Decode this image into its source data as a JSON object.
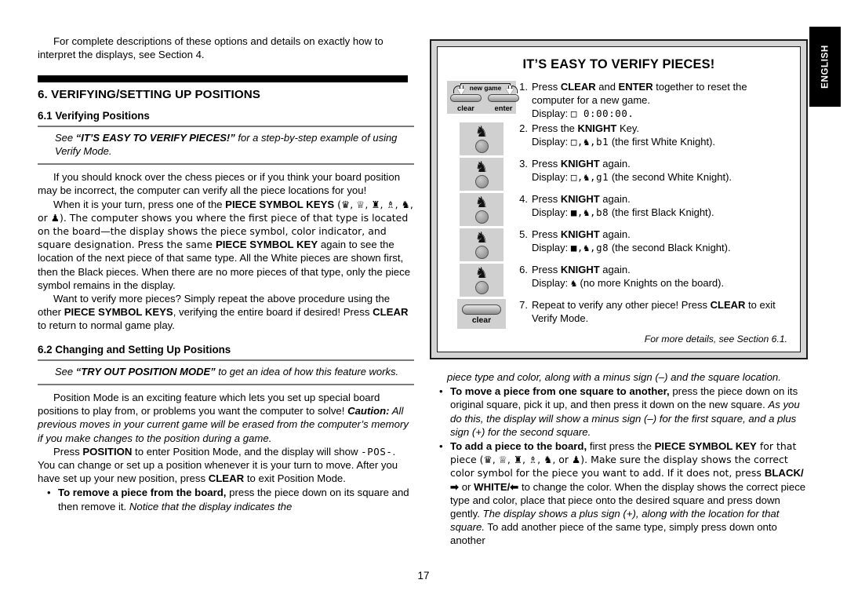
{
  "page": {
    "number": "17",
    "language_tab": "ENGLISH"
  },
  "left_column": {
    "intro_paragraph": "For complete descriptions of these options and details on exactly how to interpret the displays, see Section 4.",
    "section_heading": "6. VERIFYING/SETTING UP POSITIONS",
    "subsection_1_heading": "6.1 Verifying Positions",
    "callout_1": {
      "prefix": "See ",
      "emphasis": "“IT’S EASY TO VERIFY PIECES!”",
      "suffix": " for a step-by-step example of using Verify Mode."
    },
    "para_1": "If you should knock over the chess pieces or if you think your board position may be incorrect, the computer can verify all the piece locations for you!",
    "para_2": {
      "part1": "When it is your turn, press one of the ",
      "bold1": "PIECE SYMBOL KEYS",
      "part2": " (♛, ♕, ♜, ♗, ♞, or ♟). The computer shows you where the first piece of that type is located on the board—the display shows the piece symbol, color indicator, and square designation. Press the same ",
      "bold2": "PIECE SYMBOL KEY",
      "part3": " again to see the location of the next piece of that same type. All the White pieces are shown first, then the Black pieces. When there are no more pieces of that type, only the piece symbol remains in the display."
    },
    "para_3": {
      "part1": "Want to verify more pieces? Simply repeat the above procedure using the other ",
      "bold1": "PIECE SYMBOL KEYS",
      "part2": ", verifying the entire board if desired! Press ",
      "bold2": "CLEAR",
      "part3": " to return to normal game play."
    },
    "subsection_2_heading": "6.2 Changing and Setting Up Positions",
    "callout_2": {
      "prefix": "See ",
      "emphasis": "“TRY OUT POSITION MODE”",
      "suffix": " to get an idea of how this feature works."
    },
    "para_4": {
      "part1": "Position Mode is an exciting feature which lets you set up special board positions to play from, or problems you want the computer to solve! ",
      "caution_label": "Caution:",
      "part2": " All previous moves in your current game will be erased from the computer’s memory if you make changes to the position during a game."
    },
    "para_5": {
      "part1": "Press ",
      "bold1": "POSITION",
      "part2": " to enter Position Mode, and the display will show ",
      "lcd": "-POS-",
      "part3": ". You can change or set up a position whenever it is your turn to move. After you have set up your new position, press ",
      "bold2": "CLEAR",
      "part4": " to exit Position Mode."
    },
    "bullet_1": {
      "bullet": "•",
      "bold": "To remove a piece from the board,",
      "text": " press the piece down on its square and then remove it. ",
      "italic": "Notice that the display indicates the"
    }
  },
  "sidebox": {
    "title": "IT’S EASY TO VERIFY PIECES!",
    "footnote": "For more details, see Section 6.1.",
    "newgame_key": {
      "label": "new game",
      "left_cap": "clear",
      "right_cap": "enter"
    },
    "clear_key": {
      "cap": "clear"
    },
    "knight_glyph": "♞",
    "steps": [
      {
        "num": "1.",
        "art": "new-game-key",
        "line1_pre": "Press ",
        "line1_b1": "CLEAR",
        "line1_mid": " and ",
        "line1_b2": "ENTER",
        "line1_post": " together to reset the computer for a new game.",
        "display_label": "Display: ",
        "display_value": "□ 0:00:00.",
        "display_note": ""
      },
      {
        "num": "2.",
        "art": "knight-key",
        "line1_pre": "Press the ",
        "line1_b1": "KNIGHT",
        "line1_mid": "",
        "line1_b2": "",
        "line1_post": " Key.",
        "display_label": "Display: ",
        "display_value": "□,♞,b1",
        "display_note": " (the first White Knight)."
      },
      {
        "num": "3.",
        "art": "knight-key",
        "line1_pre": "Press ",
        "line1_b1": "KNIGHT",
        "line1_mid": "",
        "line1_b2": "",
        "line1_post": " again.",
        "display_label": "Display: ",
        "display_value": "□,♞,g1",
        "display_note": " (the second White Knight)."
      },
      {
        "num": "4.",
        "art": "knight-key",
        "line1_pre": "Press ",
        "line1_b1": "KNIGHT",
        "line1_mid": "",
        "line1_b2": "",
        "line1_post": " again.",
        "display_label": "Display: ",
        "display_value": "■,♞,b8",
        "display_note": " (the first Black Knight)."
      },
      {
        "num": "5.",
        "art": "knight-key",
        "line1_pre": "Press ",
        "line1_b1": "KNIGHT",
        "line1_mid": "",
        "line1_b2": "",
        "line1_post": " again.",
        "display_label": "Display: ",
        "display_value": "■,♞,g8",
        "display_note": " (the second Black Knight)."
      },
      {
        "num": "6.",
        "art": "knight-key",
        "line1_pre": "Press ",
        "line1_b1": "KNIGHT",
        "line1_mid": "",
        "line1_b2": "",
        "line1_post": " again.",
        "display_label": "Display: ",
        "display_value": "♞",
        "display_note": " (no more Knights on the board)."
      },
      {
        "num": "7.",
        "art": "clear-key",
        "line1_pre": "Repeat to verify any other piece! Press ",
        "line1_b1": "CLEAR",
        "line1_mid": "",
        "line1_b2": "",
        "line1_post": " to exit Verify Mode.",
        "display_label": "",
        "display_value": "",
        "display_note": ""
      }
    ]
  },
  "right_column": {
    "cont_italic": "piece type and color, along with a minus sign (–) and the square location.",
    "bullet_move": {
      "bullet": "•",
      "bold": "To move a piece from one square to another,",
      "text": " press the piece down on its original square, pick it up, and then press it down on the new square. ",
      "italic": "As you do this, the display will show a minus sign (–) for the first square, and a plus sign (+) for the second square."
    },
    "bullet_add": {
      "bullet": "•",
      "bold": "To add a piece to the board,",
      "t1": " first press the ",
      "b2": "PIECE SYMBOL KEY",
      "t2": " for that piece (♛, ♕, ♜, ♗, ♞, or ♟). Make sure the display shows the correct color symbol for the piece you want to add. If it does not, press ",
      "b3": "BLACK/➡",
      "t3": " or ",
      "b4": "WHITE/⬅",
      "t4": " to change the color. When the display shows the correct piece type and color, place that piece onto the desired square and press down gently. ",
      "italic": "The display shows a plus sign (+), along with the location for that square.",
      "t5": " To add another piece of the same type, simply press down onto another"
    }
  }
}
